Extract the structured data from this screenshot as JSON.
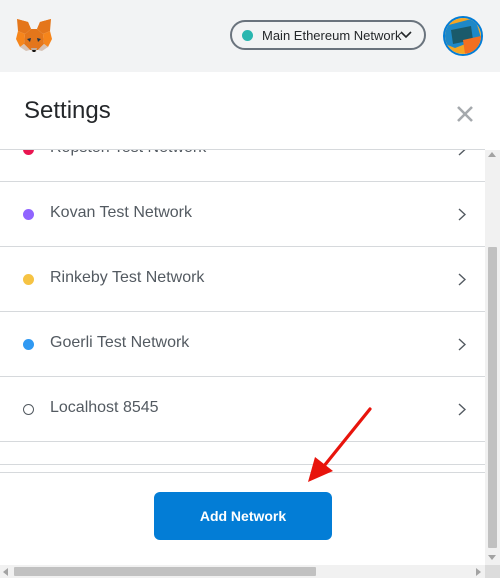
{
  "app": {
    "logo_icon": "metamask-fox-icon",
    "network_selector": {
      "label": "Main Ethereum Network",
      "dot_color": "#29b6af",
      "icon": "chevron-down-icon"
    },
    "account_icon": "account-avatar-icon"
  },
  "settings": {
    "title": "Settings",
    "close_icon": "close-icon",
    "networks": [
      {
        "label": "Ropsten Test Network",
        "dot_color": "#e91550",
        "outlined": false
      },
      {
        "label": "Kovan Test Network",
        "dot_color": "#9064ff",
        "outlined": false
      },
      {
        "label": "Rinkeby Test Network",
        "dot_color": "#f6c343",
        "outlined": false
      },
      {
        "label": "Goerli Test Network",
        "dot_color": "#3099f2",
        "outlined": false
      },
      {
        "label": "Localhost 8545",
        "dot_color": "#ffffff",
        "outlined": true
      }
    ],
    "add_button_label": "Add Network"
  },
  "colors": {
    "accent": "#037dd6",
    "annotation_arrow": "#e8140c"
  }
}
